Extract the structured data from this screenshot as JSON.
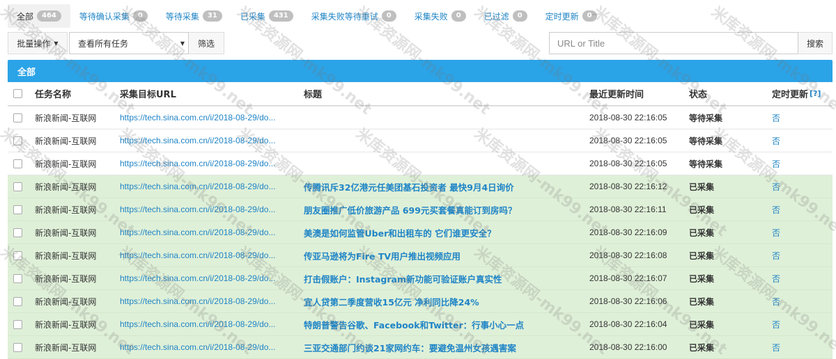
{
  "tabs": [
    {
      "label": "全部",
      "count": "464",
      "active": true
    },
    {
      "label": "等待确认采集",
      "count": "0"
    },
    {
      "label": "等待采集",
      "count": "31"
    },
    {
      "label": "已采集",
      "count": "431"
    },
    {
      "label": "采集失败等待重试",
      "count": "0"
    },
    {
      "label": "采集失败",
      "count": "0"
    },
    {
      "label": "已过滤",
      "count": "0"
    },
    {
      "label": "定时更新",
      "count": "0"
    }
  ],
  "toolbar": {
    "bulk_label": "批量操作",
    "view_select": "查看所有任务",
    "filter_label": "筛选",
    "search_placeholder": "URL or Title",
    "search_label": "搜索"
  },
  "panel": {
    "title": "全部"
  },
  "table": {
    "headers": {
      "name": "任务名称",
      "url": "采集目标URL",
      "title": "标题",
      "time": "最近更新时间",
      "status": "状态",
      "scheduled": "定时更新",
      "help": "[?]"
    },
    "rows": [
      {
        "name": "新浪新闻-互联网",
        "url": "https://tech.sina.com.cn/i/2018-08-29/do...",
        "title": "",
        "time": "2018-08-30 22:16:05",
        "status": "等待采集",
        "scheduled": "否",
        "done": false
      },
      {
        "name": "新浪新闻-互联网",
        "url": "https://tech.sina.com.cn/i/2018-08-29/do...",
        "title": "",
        "time": "2018-08-30 22:16:05",
        "status": "等待采集",
        "scheduled": "否",
        "done": false
      },
      {
        "name": "新浪新闻-互联网",
        "url": "https://tech.sina.com.cn/i/2018-08-29/do...",
        "title": "",
        "time": "2018-08-30 22:16:05",
        "status": "等待采集",
        "scheduled": "否",
        "done": false
      },
      {
        "name": "新浪新闻-互联网",
        "url": "https://tech.sina.com.cn/i/2018-08-29/do...",
        "title": "传腾讯斥32亿港元任美团基石投资者 最快9月4日询价",
        "time": "2018-08-30 22:16:12",
        "status": "已采集",
        "scheduled": "否",
        "done": true
      },
      {
        "name": "新浪新闻-互联网",
        "url": "https://tech.sina.com.cn/i/2018-08-29/do...",
        "title": "朋友圈推广低价旅游产品 699元买套餐真能订到房吗？",
        "time": "2018-08-30 22:16:11",
        "status": "已采集",
        "scheduled": "否",
        "done": true
      },
      {
        "name": "新浪新闻-互联网",
        "url": "https://tech.sina.com.cn/i/2018-08-29/do...",
        "title": "美澳是如何监管Uber和出租车的 它们谁更安全？",
        "time": "2018-08-30 22:16:09",
        "status": "已采集",
        "scheduled": "否",
        "done": true
      },
      {
        "name": "新浪新闻-互联网",
        "url": "https://tech.sina.com.cn/i/2018-08-29/do...",
        "title": "传亚马逊将为Fire TV用户推出视频应用",
        "time": "2018-08-30 22:16:08",
        "status": "已采集",
        "scheduled": "否",
        "done": true
      },
      {
        "name": "新浪新闻-互联网",
        "url": "https://tech.sina.com.cn/i/2018-08-29/do...",
        "title": "打击假账户：Instagram新功能可验证账户真实性",
        "time": "2018-08-30 22:16:07",
        "status": "已采集",
        "scheduled": "否",
        "done": true
      },
      {
        "name": "新浪新闻-互联网",
        "url": "https://tech.sina.com.cn/i/2018-08-29/do...",
        "title": "宜人贷第二季度营收15亿元 净利同比降24%",
        "time": "2018-08-30 22:16:06",
        "status": "已采集",
        "scheduled": "否",
        "done": true
      },
      {
        "name": "新浪新闻-互联网",
        "url": "https://tech.sina.com.cn/i/2018-08-29/do...",
        "title": "特朗普警告谷歌、Facebook和Twitter：行事小心一点",
        "time": "2018-08-30 22:16:04",
        "status": "已采集",
        "scheduled": "否",
        "done": true
      },
      {
        "name": "新浪新闻-互联网",
        "url": "https://tech.sina.com.cn/i/2018-08-29/do...",
        "title": "三亚交通部门约谈21家网约车：要避免温州女孩遇害案",
        "time": "2018-08-30 22:16:00",
        "status": "已采集",
        "scheduled": "否",
        "done": true
      }
    ]
  },
  "watermark": "米库资源网-mk99.net"
}
